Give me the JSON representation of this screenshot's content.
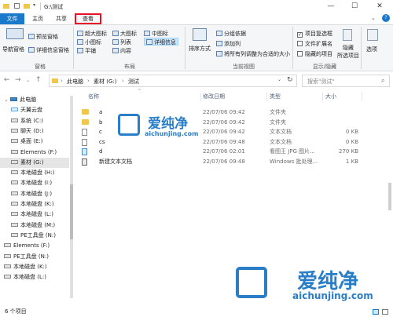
{
  "titlebar": {
    "path": "G:\\测试",
    "minimize": "—",
    "maximize": "☐",
    "close": "✕",
    "help": "?"
  },
  "tabs": [
    "文件",
    "主页",
    "共享",
    "查看"
  ],
  "ribbon": {
    "nav_pane": "导航窗格",
    "preview_pane": "预览窗格",
    "details_pane": "详细信息窗格",
    "pane_group": "窗格",
    "layout": {
      "xl_icons": "超大图标",
      "large_icons": "大图标",
      "medium_icons": "中图标",
      "small_icons": "小图标",
      "list": "列表",
      "details": "详细信息",
      "tiles": "平铺",
      "content": "内容",
      "group": "布局"
    },
    "sort": "排序方式",
    "group_by": "分组依据",
    "add_column": "添加列",
    "fit_columns": "将所有列调整为合适的大小",
    "current_view": "当前视图",
    "item_checkbox": "项目复选框",
    "file_ext": "文件扩展名",
    "hidden_items": "隐藏的项目",
    "hide_selected_1": "隐藏",
    "hide_selected_2": "所选项目",
    "show_hide": "显示/隐藏",
    "options": "选项"
  },
  "address": {
    "crumbs": [
      "此电脑",
      "素材 (G:)",
      "测试"
    ],
    "search_placeholder": "搜索\"测试\""
  },
  "nav": [
    {
      "label": "此电脑",
      "indent": 1
    },
    {
      "label": "天翼云盘",
      "indent": 2
    },
    {
      "label": "系统 (C:)",
      "indent": 2
    },
    {
      "label": "聊天 (D:)",
      "indent": 2
    },
    {
      "label": "桌面 (E:)",
      "indent": 2
    },
    {
      "label": "Elements (F:)",
      "indent": 2
    },
    {
      "label": "素材 (G:)",
      "indent": 2
    },
    {
      "label": "本地磁盘 (H:)",
      "indent": 2
    },
    {
      "label": "本地磁盘 (I:)",
      "indent": 2
    },
    {
      "label": "本地磁盘 (J:)",
      "indent": 2
    },
    {
      "label": "本地磁盘 (K:)",
      "indent": 2
    },
    {
      "label": "本地磁盘 (L:)",
      "indent": 2
    },
    {
      "label": "本地磁盘 (M:)",
      "indent": 2
    },
    {
      "label": "PE工具盘 (N:)",
      "indent": 2
    },
    {
      "label": "Elements (F:)",
      "indent": 1
    },
    {
      "label": "PE工具盘 (N:)",
      "indent": 1
    },
    {
      "label": "本地磁盘 (K:)",
      "indent": 1
    },
    {
      "label": "本地磁盘 (L:)",
      "indent": 1
    }
  ],
  "columns": [
    "名称",
    "修改日期",
    "类型",
    "大小"
  ],
  "files": [
    {
      "name": "a",
      "date": "22/07/06 09:42",
      "type": "文件夹",
      "size": "",
      "kind": "folder"
    },
    {
      "name": "b",
      "date": "22/07/06 09:42",
      "type": "文件夹",
      "size": "",
      "kind": "folder"
    },
    {
      "name": "c",
      "date": "22/07/06 09:42",
      "type": "文本文档",
      "size": "0 KB",
      "kind": "file"
    },
    {
      "name": "cs",
      "date": "22/07/06 09:48",
      "type": "文本文档",
      "size": "0 KB",
      "kind": "file"
    },
    {
      "name": "d",
      "date": "22/07/06 02:01",
      "type": "看图王 JPG 图片...",
      "size": "270 KB",
      "kind": "image"
    },
    {
      "name": "新建文本文档",
      "date": "22/07/06 09:48",
      "type": "Windows 批处理...",
      "size": "1 KB",
      "kind": "bat"
    }
  ],
  "status": {
    "count": "6 个项目"
  },
  "watermark": {
    "cn": "爱纯净",
    "url": "aichunjing.com"
  },
  "colors": {
    "accent": "#1979ca",
    "highlight": "#e81123",
    "selected": "#cce8ff"
  }
}
